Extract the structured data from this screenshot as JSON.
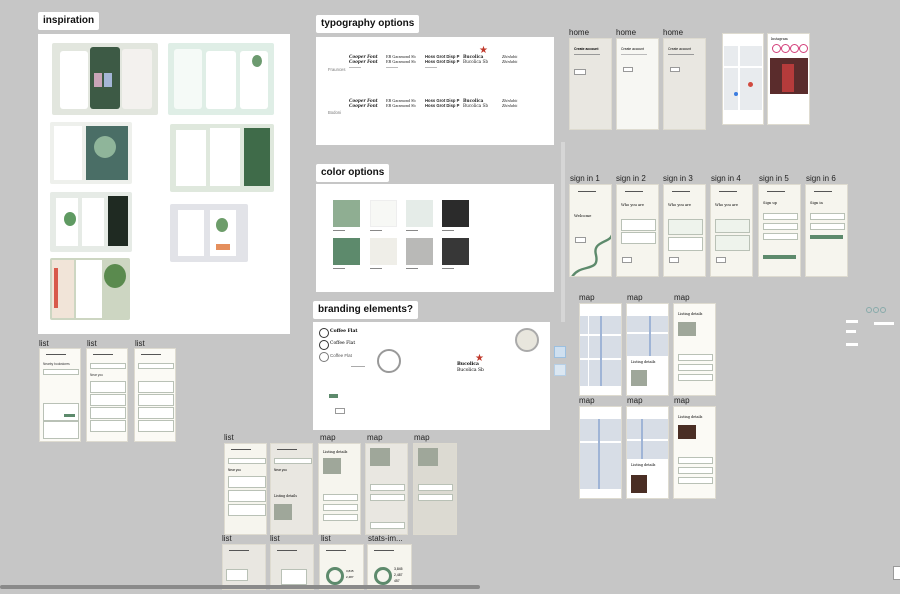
{
  "canvas": {
    "background": "#c6c6c6"
  },
  "sections": {
    "inspiration": "inspiration",
    "typography": "typography options",
    "color": "color options",
    "branding": "branding elements?"
  },
  "frames": {
    "home": [
      "home",
      "home",
      "home"
    ],
    "sign_in": [
      "sign in 1",
      "sign in 2",
      "sign in 3",
      "sign in 4",
      "sign in 5",
      "sign in 6"
    ],
    "map_right_top": [
      "map",
      "map",
      "map"
    ],
    "map_right_bottom": [
      "map",
      "map",
      "map"
    ],
    "list_left": [
      "list",
      "list",
      "list"
    ],
    "list_mid": [
      "list"
    ],
    "map_mid": [
      "map",
      "map",
      "map"
    ],
    "bottom_row": [
      "list",
      "list",
      "list",
      "stats-im..."
    ]
  },
  "colors": {
    "swatches_row1": [
      "#8fae92",
      "#f7f8f5",
      "#e5ece8",
      "#2b2b2b"
    ],
    "swatches_row2": [
      "#5d8a6c",
      "#efeee8",
      "#b9b9b7",
      "#373737"
    ],
    "accent": "#5d8a6c"
  },
  "branding": {
    "names": [
      "Coffee Flat",
      "Coffee Flat",
      "Coffee Flat"
    ],
    "wordmark": [
      "Bucolica",
      "Bucolica Sb"
    ]
  },
  "typography": {
    "row_labels": [
      "Fraunces",
      "Bodoni"
    ],
    "samples_top": [
      [
        "Cooper Font",
        "Cooper Font"
      ],
      [
        "EB Garamond Sb",
        "EB Garamond Sb"
      ],
      [
        "Hoss Grot Disp P",
        "Hoss Grot Disp P"
      ],
      [
        "Bucolica",
        "Bucolica Sb"
      ],
      [
        "Zhinlabit",
        "Zhinlabit"
      ]
    ],
    "samples_bottom": [
      [
        "Cooper Font",
        "Cooper Font"
      ],
      [
        "EB Garamond Sb",
        "EB Garamond Sb"
      ],
      [
        "Hoss Grot Disp P",
        "Hoss Grot Disp P"
      ],
      [
        "Bucolica",
        "Bucolica Sb"
      ],
      [
        "Zhinlabit",
        "Zhinlabit"
      ]
    ]
  },
  "screens": {
    "home_titles": [
      "Create account",
      "Create account",
      "Create account"
    ],
    "sign_in_titles": [
      "Welcome",
      "Who you are",
      "Who you are",
      "Who you are",
      "Sign up",
      "Sign in"
    ],
    "list_title": "Nearby bookstores",
    "list_near": "Near you",
    "map_title": "Listing details",
    "stats_numbers": [
      "3,845",
      "2,487",
      "457"
    ],
    "social_title": "Instagram"
  }
}
